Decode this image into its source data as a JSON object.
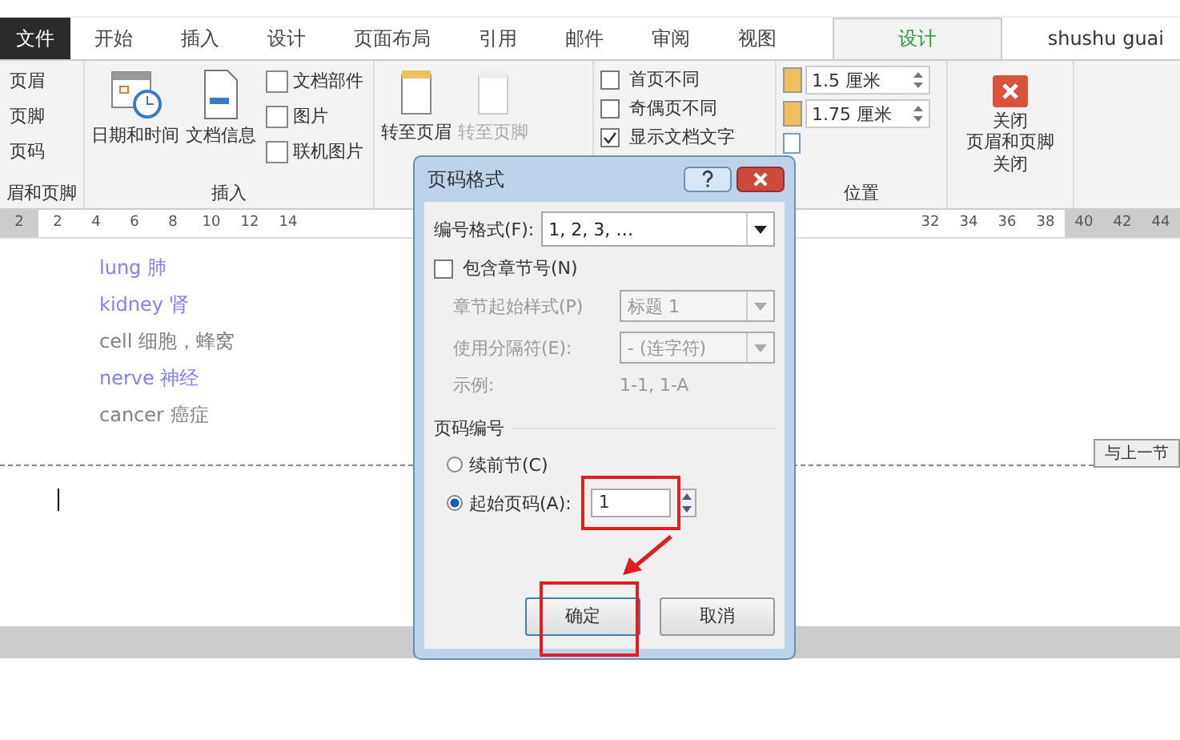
{
  "tabs": [
    {
      "label": "文件",
      "kind": "file",
      "selected": false
    },
    {
      "label": "开始",
      "kind": "tab",
      "selected": false
    },
    {
      "label": "插入",
      "kind": "tab",
      "selected": false
    },
    {
      "label": "设计",
      "kind": "tab",
      "selected": false
    },
    {
      "label": "页面布局",
      "kind": "tab",
      "selected": false
    },
    {
      "label": "引用",
      "kind": "tab",
      "selected": false
    },
    {
      "label": "邮件",
      "kind": "tab",
      "selected": false
    },
    {
      "label": "审阅",
      "kind": "tab",
      "selected": false
    },
    {
      "label": "视图",
      "kind": "tab",
      "selected": false
    },
    {
      "label": "设计",
      "kind": "context",
      "selected": true
    }
  ],
  "user": "shushu guai",
  "ribbon": {
    "header_footer": {
      "items": [
        "页眉",
        "页脚",
        "页码"
      ],
      "label": "眉和页脚"
    },
    "insert": {
      "big": [
        "日期和时间",
        "文档信息"
      ],
      "small": [
        "文档部件",
        "图片",
        "联机图片"
      ],
      "label": "插入"
    },
    "navigation": {
      "items": [
        {
          "label": "转至页眉",
          "disabled": false
        },
        {
          "label": "转至页脚",
          "disabled": true
        }
      ]
    },
    "options": [
      {
        "label": "首页不同",
        "checked": false
      },
      {
        "label": "奇偶页不同",
        "checked": false
      },
      {
        "label": "显示文档文字",
        "checked": true
      }
    ],
    "position": {
      "fields": [
        "1.5 厘米",
        "1.75 厘米"
      ],
      "label": "位置"
    },
    "close": {
      "button": [
        "关闭",
        "页眉和页脚"
      ],
      "label": "关闭"
    }
  },
  "ruler": {
    "left": [
      {
        "label": "2",
        "margin": true
      },
      {
        "label": "2",
        "margin": false
      },
      {
        "label": "4",
        "margin": false
      },
      {
        "label": "6",
        "margin": false
      },
      {
        "label": "8",
        "margin": false
      },
      {
        "label": "10",
        "margin": false
      },
      {
        "label": "12",
        "margin": false
      },
      {
        "label": "14",
        "margin": false
      }
    ],
    "right": [
      {
        "label": "32",
        "margin": false
      },
      {
        "label": "34",
        "margin": false
      },
      {
        "label": "36",
        "margin": false
      },
      {
        "label": "38",
        "margin": false
      },
      {
        "label": "40",
        "margin": true
      },
      {
        "label": "42",
        "margin": true
      },
      {
        "label": "44",
        "margin": true
      }
    ]
  },
  "document": {
    "lines": [
      {
        "text": "lung  肺",
        "color": "#8080ff"
      },
      {
        "text": "kidney  肾",
        "color": "#8080ff"
      },
      {
        "text": "cell  细胞，蜂窝",
        "color": "#808080"
      },
      {
        "text": "nerve  神经",
        "color": "#8080ff"
      },
      {
        "text": "cancer  癌症",
        "color": "#808080"
      }
    ],
    "header_tag": "与上一节"
  },
  "dialog": {
    "title": "页码格式",
    "format_label": "编号格式(F):",
    "format_value": "1, 2, 3, …",
    "include_chapter": {
      "label": "包含章节号(N)",
      "checked": false
    },
    "chapter_style": {
      "label": "章节起始样式(P)",
      "value": "标题 1",
      "disabled": true
    },
    "separator": {
      "label": "使用分隔符(E):",
      "value": "-   (连字符)",
      "disabled": true
    },
    "example": {
      "label": "示例:",
      "value": "1-1, 1-A"
    },
    "section": "页码编号",
    "radios": [
      {
        "label": "续前节(C)",
        "selected": false
      },
      {
        "label": "起始页码(A):",
        "selected": true
      }
    ],
    "start_value": "1",
    "buttons": [
      "确定",
      "取消"
    ]
  }
}
